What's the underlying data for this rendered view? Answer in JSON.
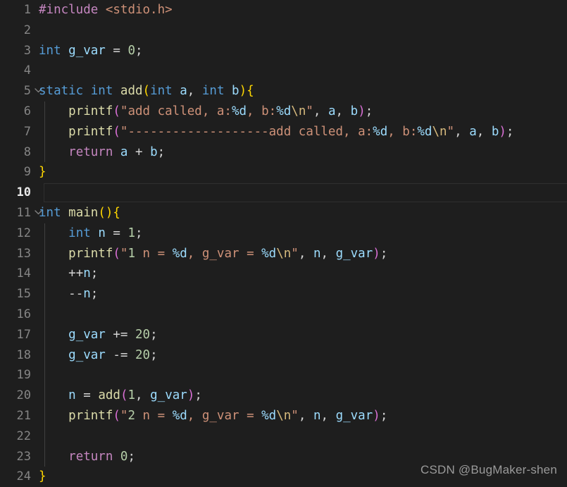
{
  "editor": {
    "theme": "dark-plus",
    "background": "#1e1e1e",
    "active_line": 10,
    "folded_lines": [
      5,
      11
    ],
    "colors": {
      "background": "#1e1e1e",
      "line_number": "#858585",
      "line_number_active": "#e8e8e8",
      "keyword_type": "#569cd6",
      "keyword_control": "#c586c0",
      "function": "#dcdcaa",
      "variable": "#9cdcfe",
      "string": "#ce9178",
      "format_spec": "#9cdcfe",
      "escape": "#d7ba7d",
      "number": "#b5cea8",
      "operator": "#d4d4d4",
      "bracket_level_0": "#ffd700",
      "bracket_level_1": "#da70d6",
      "bracket_level_2": "#179fff",
      "indent_guide": "#404040",
      "active_line_border": "#2f2f2f",
      "watermark": "#9a9a9a"
    },
    "language": "c",
    "total_lines": 24
  },
  "watermark": {
    "text": "CSDN @BugMaker-shen"
  },
  "lines": [
    {
      "number": "1",
      "text": "#include <stdio.h>"
    },
    {
      "number": "2",
      "text": ""
    },
    {
      "number": "3",
      "text": "int g_var = 0;"
    },
    {
      "number": "4",
      "text": ""
    },
    {
      "number": "5",
      "text": "static int add(int a, int b){"
    },
    {
      "number": "6",
      "text": "    printf(\"add called, a:%d, b:%d\\n\", a, b);"
    },
    {
      "number": "7",
      "text": "    printf(\"-------------------add called, a:%d, b:%d\\n\", a, b);"
    },
    {
      "number": "8",
      "text": "    return a + b;"
    },
    {
      "number": "9",
      "text": "}"
    },
    {
      "number": "10",
      "text": ""
    },
    {
      "number": "11",
      "text": "int main(){"
    },
    {
      "number": "12",
      "text": "    int n = 1;"
    },
    {
      "number": "13",
      "text": "    printf(\"1 n = %d, g_var = %d\\n\", n, g_var);"
    },
    {
      "number": "14",
      "text": "    ++n;"
    },
    {
      "number": "15",
      "text": "    --n;"
    },
    {
      "number": "16",
      "text": ""
    },
    {
      "number": "17",
      "text": "    g_var += 20;"
    },
    {
      "number": "18",
      "text": "    g_var -= 20;"
    },
    {
      "number": "19",
      "text": ""
    },
    {
      "number": "20",
      "text": "    n = add(1, g_var);"
    },
    {
      "number": "21",
      "text": "    printf(\"2 n = %d, g_var = %d\\n\", n, g_var);"
    },
    {
      "number": "22",
      "text": ""
    },
    {
      "number": "23",
      "text": "    return 0;"
    },
    {
      "number": "24",
      "text": "}"
    }
  ],
  "tokens": [
    [
      {
        "t": "#include",
        "c": "ctl"
      },
      {
        "t": " ",
        "c": "plain"
      },
      {
        "t": "<stdio.h>",
        "c": "str"
      }
    ],
    [],
    [
      {
        "t": "int",
        "c": "k"
      },
      {
        "t": " ",
        "c": "plain"
      },
      {
        "t": "g_var",
        "c": "var"
      },
      {
        "t": " ",
        "c": "plain"
      },
      {
        "t": "=",
        "c": "op"
      },
      {
        "t": " ",
        "c": "plain"
      },
      {
        "t": "0",
        "c": "num"
      },
      {
        "t": ";",
        "c": "op"
      }
    ],
    [],
    [
      {
        "t": "static",
        "c": "k"
      },
      {
        "t": " ",
        "c": "plain"
      },
      {
        "t": "int",
        "c": "k"
      },
      {
        "t": " ",
        "c": "plain"
      },
      {
        "t": "add",
        "c": "fn"
      },
      {
        "t": "(",
        "c": "p0"
      },
      {
        "t": "int",
        "c": "k"
      },
      {
        "t": " ",
        "c": "plain"
      },
      {
        "t": "a",
        "c": "var"
      },
      {
        "t": ",",
        "c": "op"
      },
      {
        "t": " ",
        "c": "plain"
      },
      {
        "t": "int",
        "c": "k"
      },
      {
        "t": " ",
        "c": "plain"
      },
      {
        "t": "b",
        "c": "var"
      },
      {
        "t": ")",
        "c": "p0"
      },
      {
        "t": "{",
        "c": "p0"
      }
    ],
    [
      {
        "t": "    ",
        "c": "plain"
      },
      {
        "t": "printf",
        "c": "fn"
      },
      {
        "t": "(",
        "c": "p1"
      },
      {
        "t": "\"add called, a:",
        "c": "str"
      },
      {
        "t": "%d",
        "c": "fmt"
      },
      {
        "t": ", b:",
        "c": "str"
      },
      {
        "t": "%d",
        "c": "fmt"
      },
      {
        "t": "\\n",
        "c": "esc"
      },
      {
        "t": "\"",
        "c": "str"
      },
      {
        "t": ",",
        "c": "op"
      },
      {
        "t": " ",
        "c": "plain"
      },
      {
        "t": "a",
        "c": "var"
      },
      {
        "t": ",",
        "c": "op"
      },
      {
        "t": " ",
        "c": "plain"
      },
      {
        "t": "b",
        "c": "var"
      },
      {
        "t": ")",
        "c": "p1"
      },
      {
        "t": ";",
        "c": "op"
      }
    ],
    [
      {
        "t": "    ",
        "c": "plain"
      },
      {
        "t": "printf",
        "c": "fn"
      },
      {
        "t": "(",
        "c": "p1"
      },
      {
        "t": "\"-------------------add called, a:",
        "c": "str"
      },
      {
        "t": "%d",
        "c": "fmt"
      },
      {
        "t": ", b:",
        "c": "str"
      },
      {
        "t": "%d",
        "c": "fmt"
      },
      {
        "t": "\\n",
        "c": "esc"
      },
      {
        "t": "\"",
        "c": "str"
      },
      {
        "t": ",",
        "c": "op"
      },
      {
        "t": " ",
        "c": "plain"
      },
      {
        "t": "a",
        "c": "var"
      },
      {
        "t": ",",
        "c": "op"
      },
      {
        "t": " ",
        "c": "plain"
      },
      {
        "t": "b",
        "c": "var"
      },
      {
        "t": ")",
        "c": "p1"
      },
      {
        "t": ";",
        "c": "op"
      }
    ],
    [
      {
        "t": "    ",
        "c": "plain"
      },
      {
        "t": "return",
        "c": "ctl"
      },
      {
        "t": " ",
        "c": "plain"
      },
      {
        "t": "a",
        "c": "var"
      },
      {
        "t": " ",
        "c": "plain"
      },
      {
        "t": "+",
        "c": "op"
      },
      {
        "t": " ",
        "c": "plain"
      },
      {
        "t": "b",
        "c": "var"
      },
      {
        "t": ";",
        "c": "op"
      }
    ],
    [
      {
        "t": "}",
        "c": "p0"
      }
    ],
    [],
    [
      {
        "t": "int",
        "c": "k"
      },
      {
        "t": " ",
        "c": "plain"
      },
      {
        "t": "main",
        "c": "fn"
      },
      {
        "t": "(",
        "c": "p0"
      },
      {
        "t": ")",
        "c": "p0"
      },
      {
        "t": "{",
        "c": "p0"
      }
    ],
    [
      {
        "t": "    ",
        "c": "plain"
      },
      {
        "t": "int",
        "c": "k"
      },
      {
        "t": " ",
        "c": "plain"
      },
      {
        "t": "n",
        "c": "var"
      },
      {
        "t": " ",
        "c": "plain"
      },
      {
        "t": "=",
        "c": "op"
      },
      {
        "t": " ",
        "c": "plain"
      },
      {
        "t": "1",
        "c": "num"
      },
      {
        "t": ";",
        "c": "op"
      }
    ],
    [
      {
        "t": "    ",
        "c": "plain"
      },
      {
        "t": "printf",
        "c": "fn"
      },
      {
        "t": "(",
        "c": "p1"
      },
      {
        "t": "\"",
        "c": "str"
      },
      {
        "t": "1",
        "c": "num"
      },
      {
        "t": " n = ",
        "c": "str"
      },
      {
        "t": "%d",
        "c": "fmt"
      },
      {
        "t": ", g_var = ",
        "c": "str"
      },
      {
        "t": "%d",
        "c": "fmt"
      },
      {
        "t": "\\n",
        "c": "esc"
      },
      {
        "t": "\"",
        "c": "str"
      },
      {
        "t": ",",
        "c": "op"
      },
      {
        "t": " ",
        "c": "plain"
      },
      {
        "t": "n",
        "c": "var"
      },
      {
        "t": ",",
        "c": "op"
      },
      {
        "t": " ",
        "c": "plain"
      },
      {
        "t": "g_var",
        "c": "var"
      },
      {
        "t": ")",
        "c": "p1"
      },
      {
        "t": ";",
        "c": "op"
      }
    ],
    [
      {
        "t": "    ",
        "c": "plain"
      },
      {
        "t": "++",
        "c": "op"
      },
      {
        "t": "n",
        "c": "var"
      },
      {
        "t": ";",
        "c": "op"
      }
    ],
    [
      {
        "t": "    ",
        "c": "plain"
      },
      {
        "t": "--",
        "c": "op"
      },
      {
        "t": "n",
        "c": "var"
      },
      {
        "t": ";",
        "c": "op"
      }
    ],
    [],
    [
      {
        "t": "    ",
        "c": "plain"
      },
      {
        "t": "g_var",
        "c": "var"
      },
      {
        "t": " ",
        "c": "plain"
      },
      {
        "t": "+=",
        "c": "op"
      },
      {
        "t": " ",
        "c": "plain"
      },
      {
        "t": "20",
        "c": "num"
      },
      {
        "t": ";",
        "c": "op"
      }
    ],
    [
      {
        "t": "    ",
        "c": "plain"
      },
      {
        "t": "g_var",
        "c": "var"
      },
      {
        "t": " ",
        "c": "plain"
      },
      {
        "t": "-=",
        "c": "op"
      },
      {
        "t": " ",
        "c": "plain"
      },
      {
        "t": "20",
        "c": "num"
      },
      {
        "t": ";",
        "c": "op"
      }
    ],
    [],
    [
      {
        "t": "    ",
        "c": "plain"
      },
      {
        "t": "n",
        "c": "var"
      },
      {
        "t": " ",
        "c": "plain"
      },
      {
        "t": "=",
        "c": "op"
      },
      {
        "t": " ",
        "c": "plain"
      },
      {
        "t": "add",
        "c": "fn"
      },
      {
        "t": "(",
        "c": "p1"
      },
      {
        "t": "1",
        "c": "num"
      },
      {
        "t": ",",
        "c": "op"
      },
      {
        "t": " ",
        "c": "plain"
      },
      {
        "t": "g_var",
        "c": "var"
      },
      {
        "t": ")",
        "c": "p1"
      },
      {
        "t": ";",
        "c": "op"
      }
    ],
    [
      {
        "t": "    ",
        "c": "plain"
      },
      {
        "t": "printf",
        "c": "fn"
      },
      {
        "t": "(",
        "c": "p1"
      },
      {
        "t": "\"",
        "c": "str"
      },
      {
        "t": "2",
        "c": "num"
      },
      {
        "t": " n = ",
        "c": "str"
      },
      {
        "t": "%d",
        "c": "fmt"
      },
      {
        "t": ", g_var = ",
        "c": "str"
      },
      {
        "t": "%d",
        "c": "fmt"
      },
      {
        "t": "\\n",
        "c": "esc"
      },
      {
        "t": "\"",
        "c": "str"
      },
      {
        "t": ",",
        "c": "op"
      },
      {
        "t": " ",
        "c": "plain"
      },
      {
        "t": "n",
        "c": "var"
      },
      {
        "t": ",",
        "c": "op"
      },
      {
        "t": " ",
        "c": "plain"
      },
      {
        "t": "g_var",
        "c": "var"
      },
      {
        "t": ")",
        "c": "p1"
      },
      {
        "t": ";",
        "c": "op"
      }
    ],
    [],
    [
      {
        "t": "    ",
        "c": "plain"
      },
      {
        "t": "return",
        "c": "ctl"
      },
      {
        "t": " ",
        "c": "plain"
      },
      {
        "t": "0",
        "c": "num"
      },
      {
        "t": ";",
        "c": "op"
      }
    ],
    [
      {
        "t": "}",
        "c": "p0"
      }
    ]
  ],
  "indent_guides": [
    false,
    false,
    false,
    false,
    false,
    true,
    true,
    true,
    false,
    false,
    false,
    true,
    true,
    true,
    true,
    true,
    true,
    true,
    true,
    true,
    true,
    true,
    true,
    false
  ]
}
